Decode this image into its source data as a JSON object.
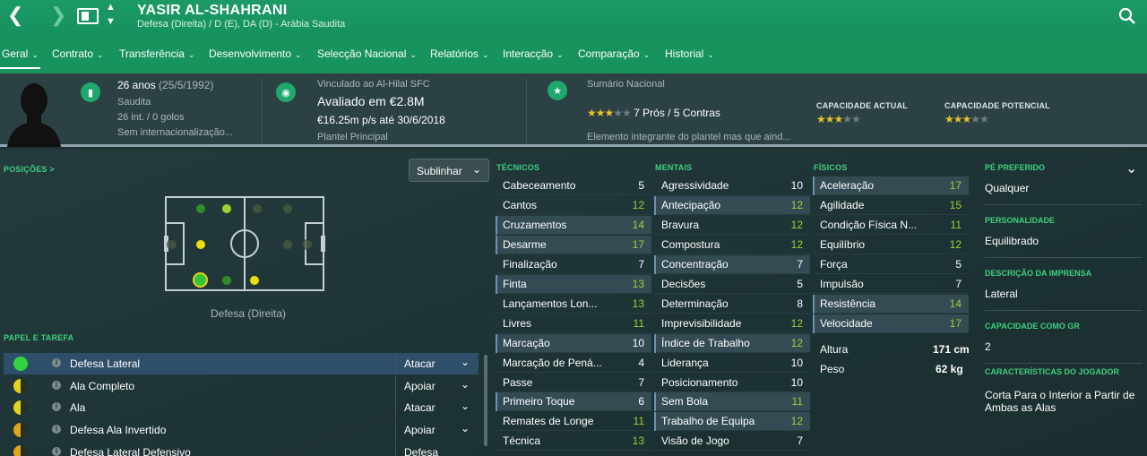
{
  "header": {
    "title": "YASIR AL-SHAHRANI",
    "subtitle": "Defesa (Direita) / D (E), DA (D) - Arábia Saudita"
  },
  "tabs": [
    {
      "label": "Geral"
    },
    {
      "label": "Contrato"
    },
    {
      "label": "Transferência"
    },
    {
      "label": "Desenvolvimento"
    },
    {
      "label": "Selecção Nacional"
    },
    {
      "label": "Relatórios"
    },
    {
      "label": "Interacção"
    },
    {
      "label": "Comparação"
    },
    {
      "label": "Historial"
    }
  ],
  "info": {
    "age": "26 anos",
    "dob": "(25/5/1992)",
    "nationality": "Saudita",
    "caps": "26 int. / 0 golos",
    "intl": "Sem internacionalização...",
    "club": "Vinculado ao Al-Hilal SFC",
    "value": "Avaliado em €2.8M",
    "wage": "€16.25m p/s até 30/6/2018",
    "squad": "Plantel Principal",
    "summary_label": "Sumário Nacional",
    "pros_cons": "7 Prós / 5 Contras",
    "summary_text": "Elemento integrante do plantel mas que aind...",
    "ca_label": "CAPACIDADE ACTUAL",
    "pa_label": "CAPACIDADE POTENCIAL",
    "summary_stars": 3,
    "ca_stars": 3,
    "pa_stars": 3
  },
  "positions": {
    "header": "POSIÇÕES >",
    "select_label": "Sublinhar",
    "position_name": "Defesa (Direita)"
  },
  "roles": {
    "header": "PAPEL E TAREFA",
    "items": [
      {
        "name": "Defesa Lateral",
        "duty": "Atacar"
      },
      {
        "name": "Ala Completo",
        "duty": "Apoiar"
      },
      {
        "name": "Ala",
        "duty": "Atacar"
      },
      {
        "name": "Defesa Ala Invertido",
        "duty": "Apoiar"
      },
      {
        "name": "Defesa Lateral Defensivo",
        "duty": "Defesa"
      }
    ]
  },
  "technical": {
    "header": "TÉCNICOS",
    "items": [
      {
        "name": "Cabeceamento",
        "value": "5"
      },
      {
        "name": "Cantos",
        "value": "12"
      },
      {
        "name": "Cruzamentos",
        "value": "14"
      },
      {
        "name": "Desarme",
        "value": "17"
      },
      {
        "name": "Finalização",
        "value": "7"
      },
      {
        "name": "Finta",
        "value": "13"
      },
      {
        "name": "Lançamentos Lon...",
        "value": "13"
      },
      {
        "name": "Livres",
        "value": "11"
      },
      {
        "name": "Marcação",
        "value": "10"
      },
      {
        "name": "Marcação de Pená...",
        "value": "4"
      },
      {
        "name": "Passe",
        "value": "7"
      },
      {
        "name": "Primeiro Toque",
        "value": "6"
      },
      {
        "name": "Remates de Longe",
        "value": "11"
      },
      {
        "name": "Técnica",
        "value": "13"
      }
    ]
  },
  "mental": {
    "header": "MENTAIS",
    "items": [
      {
        "name": "Agressividade",
        "value": "10"
      },
      {
        "name": "Antecipação",
        "value": "12"
      },
      {
        "name": "Bravura",
        "value": "12"
      },
      {
        "name": "Compostura",
        "value": "12"
      },
      {
        "name": "Concentração",
        "value": "7"
      },
      {
        "name": "Decisões",
        "value": "5"
      },
      {
        "name": "Determinação",
        "value": "8"
      },
      {
        "name": "Imprevisibilidade",
        "value": "12"
      },
      {
        "name": "Índice de Trabalho",
        "value": "12"
      },
      {
        "name": "Liderança",
        "value": "10"
      },
      {
        "name": "Posicionamento",
        "value": "10"
      },
      {
        "name": "Sem Bola",
        "value": "11"
      },
      {
        "name": "Trabalho de Equipa",
        "value": "12"
      },
      {
        "name": "Visão de Jogo",
        "value": "7"
      }
    ]
  },
  "physical": {
    "header": "FÍSICOS",
    "items": [
      {
        "name": "Aceleração",
        "value": "17"
      },
      {
        "name": "Agilidade",
        "value": "15"
      },
      {
        "name": "Condição Física N...",
        "value": "11"
      },
      {
        "name": "Equilíbrio",
        "value": "12"
      },
      {
        "name": "Força",
        "value": "5"
      },
      {
        "name": "Impulsão",
        "value": "7"
      },
      {
        "name": "Resistência",
        "value": "14"
      },
      {
        "name": "Velocidade",
        "value": "17"
      }
    ],
    "height_label": "Altura",
    "height": "171 cm",
    "weight_label": "Peso",
    "weight": "62 kg"
  },
  "side": {
    "foot_label": "PÉ PREFERIDO",
    "foot": "Qualquer",
    "personality_label": "PERSONALIDADE",
    "personality": "Equilibrado",
    "press_label": "DESCRIÇÃO DA IMPRENSA",
    "press": "Lateral",
    "gk_label": "CAPACIDADE COMO GR",
    "gk": "2",
    "traits_label": "CARACTERÍSTICAS DO JOGADOR",
    "traits": "Corta Para o Interior a Partir de Ambas as Alas"
  },
  "colors": {
    "accent": "#17935e",
    "highlight_green": "#9ed136"
  }
}
